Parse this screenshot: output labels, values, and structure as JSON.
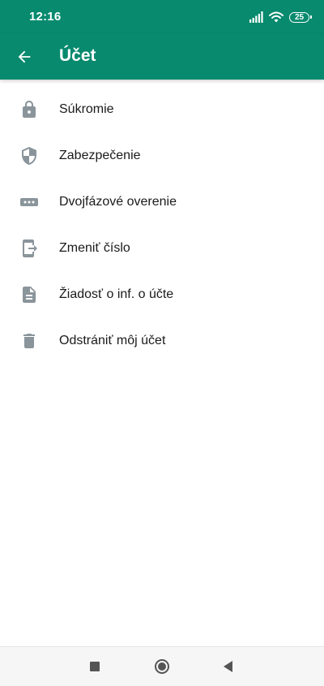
{
  "status_bar": {
    "time": "12:16",
    "battery_level": "25",
    "icons": [
      "signal-icon",
      "wifi-icon",
      "battery-icon"
    ]
  },
  "app_bar": {
    "title": "Účet",
    "back_icon": "arrow-back-icon"
  },
  "menu": {
    "items": [
      {
        "label": "Súkromie",
        "icon": "lock-icon"
      },
      {
        "label": "Zabezpečenie",
        "icon": "shield-icon"
      },
      {
        "label": "Dvojfázové overenie",
        "icon": "dots-icon"
      },
      {
        "label": "Zmeniť číslo",
        "icon": "phone-forward-icon"
      },
      {
        "label": "Žiadosť o inf. o účte",
        "icon": "document-icon"
      },
      {
        "label": "Odstrániť môj účet",
        "icon": "trash-icon"
      }
    ]
  },
  "nav_bar": {
    "buttons": [
      "recents-button",
      "home-button",
      "back-button"
    ]
  },
  "colors": {
    "primary": "#078a6e",
    "icon_gray": "#8a949b",
    "text": "#1a1a1a",
    "nav_bar_bg": "#f6f6f6"
  }
}
